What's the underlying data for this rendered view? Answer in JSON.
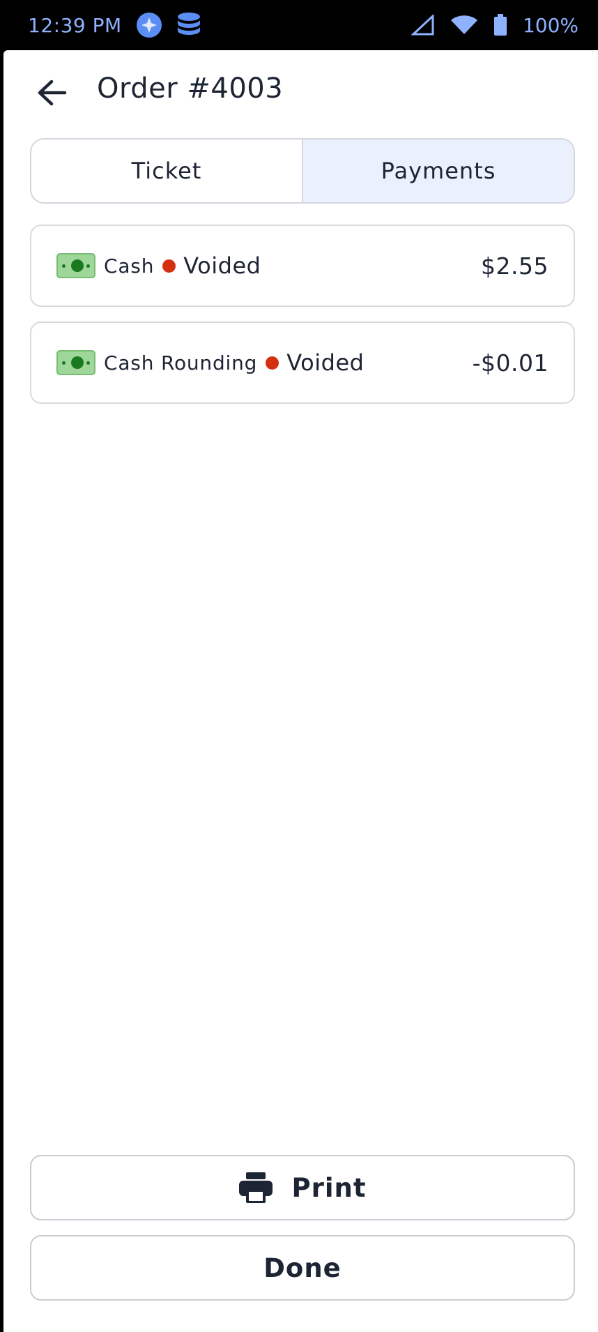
{
  "status_bar": {
    "time": "12:39 PM",
    "battery": "100%",
    "icons": [
      "compass-icon",
      "database-icon",
      "cell-signal-icon",
      "wifi-icon",
      "battery-icon"
    ]
  },
  "header": {
    "title": "Order #4003",
    "back_icon": "arrow-left-icon"
  },
  "tabs": [
    {
      "label": "Ticket",
      "active": false
    },
    {
      "label": "Payments",
      "active": true
    }
  ],
  "payments": [
    {
      "method": "Cash",
      "status": "Voided",
      "amount": "$2.55",
      "icon": "cash-bill-icon"
    },
    {
      "method": "Cash Rounding",
      "status": "Voided",
      "amount": "-$0.01",
      "icon": "cash-bill-icon"
    }
  ],
  "actions": {
    "print_label": "Print",
    "done_label": "Done"
  },
  "colors": {
    "accent": "#8fb2ff",
    "tab_active_bg": "#eaf1fd",
    "void_dot": "#d2300f",
    "text": "#1d2433"
  }
}
